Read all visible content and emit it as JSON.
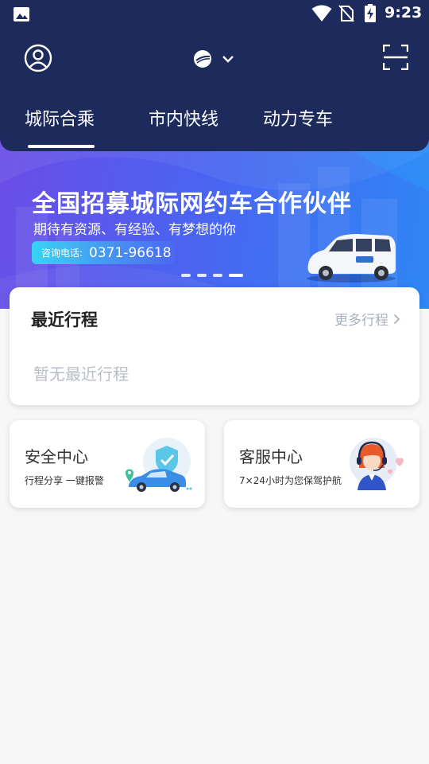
{
  "status_bar": {
    "time": "9:23"
  },
  "header": {
    "tabs": [
      {
        "label": "城际合乘",
        "active": true
      },
      {
        "label": "市内快线",
        "active": false
      },
      {
        "label": "动力专车",
        "active": false
      }
    ]
  },
  "banner": {
    "title": "全国招募城际网约车合作伙伴",
    "subtitle": "期待有资源、有经验、有梦想的你",
    "phone_label": "咨询电话:",
    "phone_number": "0371-96618",
    "slide_count": 4,
    "active_slide": 4
  },
  "recent_trips": {
    "title": "最近行程",
    "more_label": "更多行程",
    "empty_text": "暂无最近行程"
  },
  "services": {
    "safety": {
      "title": "安全中心",
      "subtitle": "行程分享   一键报警"
    },
    "customer_service": {
      "title": "客服中心",
      "subtitle": "7×24小时为您保驾护航"
    }
  },
  "colors": {
    "header_bg": "#1c2a5c",
    "banner_start": "#6c4de6",
    "banner_end": "#2f86f5",
    "page_bg": "#f7f7f8"
  }
}
